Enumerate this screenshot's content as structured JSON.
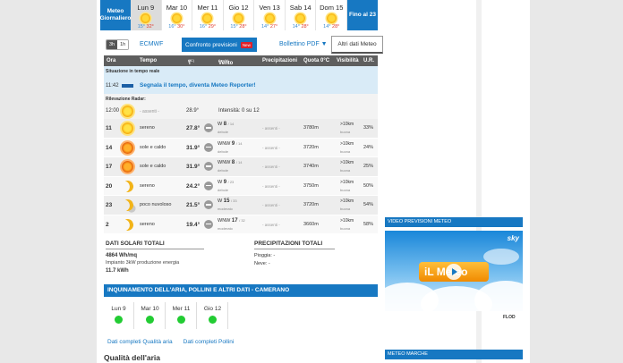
{
  "days": {
    "left_label": "Meteo Giornaliero",
    "right_label": "Fino al 23",
    "items": [
      {
        "name": "Lun 9",
        "min": "15°",
        "max": "32°",
        "active": true
      },
      {
        "name": "Mar 10",
        "min": "16°",
        "max": "30°"
      },
      {
        "name": "Mer 11",
        "min": "16°",
        "max": "29°"
      },
      {
        "name": "Gio 12",
        "min": "15°",
        "max": "28°"
      },
      {
        "name": "Ven 13",
        "min": "14°",
        "max": "27°"
      },
      {
        "name": "Sab 14",
        "min": "14°",
        "max": "28°"
      },
      {
        "name": "Dom 15",
        "min": "14°",
        "max": "28°"
      }
    ]
  },
  "toolbar": {
    "seg_3h": "3h",
    "seg_1h": "1h",
    "model": "ECMWF",
    "compare": "Confronto previsioni",
    "new_badge": "New",
    "pdf": "Bollettino PDF ▼",
    "altri": "Altri dati Meteo"
  },
  "table": {
    "headers": {
      "ora": "Ora",
      "tempo": "Tempo",
      "t": "T",
      "t_unit": "(°C)",
      "vento": "Vento",
      "vento_unit": "(km/h)",
      "prec": "Precipitazioni",
      "quota": "Quota 0°C",
      "vis": "Visibilità",
      "ur": "U.R."
    },
    "realtime": {
      "label": "Situazione in tempo reale",
      "time": "11:42",
      "msg": "Segnala il tempo, diventa Meteo Reporter!"
    },
    "radar": {
      "label": "Rilevazione Radar:",
      "time": "12:00",
      "assenti": "- assenti -",
      "temp": "28.9°",
      "intensity": "Intensità: 0 su 12"
    },
    "rows": [
      {
        "ora": "11",
        "icon": "sun",
        "cielo": "sereno",
        "temp": "27.8°",
        "dir": "W",
        "speed": "8",
        "gust": "/ 14",
        "desc": "debole",
        "prec": "- assenti -",
        "zero": "3780m",
        "vis": ">10km",
        "visd": "buona",
        "ur": "33%"
      },
      {
        "ora": "14",
        "icon": "hot",
        "cielo": "sole e caldo",
        "temp": "31.9°",
        "dir": "WNW",
        "speed": "9",
        "gust": "/ 14",
        "desc": "debole",
        "prec": "- assenti -",
        "zero": "3720m",
        "vis": ">10km",
        "visd": "buona",
        "ur": "24%"
      },
      {
        "ora": "17",
        "icon": "hot",
        "cielo": "sole e caldo",
        "temp": "31.9°",
        "dir": "WNW",
        "speed": "8",
        "gust": "/ 14",
        "desc": "debole",
        "prec": "- assenti -",
        "zero": "3740m",
        "vis": ">10km",
        "visd": "buona",
        "ur": "25%"
      },
      {
        "ora": "20",
        "icon": "moon",
        "cielo": "sereno",
        "temp": "24.2°",
        "dir": "W",
        "speed": "9",
        "gust": "/ 23",
        "desc": "debole",
        "prec": "- assenti -",
        "zero": "3750m",
        "vis": ">10km",
        "visd": "buona",
        "ur": "50%"
      },
      {
        "ora": "23",
        "icon": "mooncloud",
        "cielo": "poco nuvoloso",
        "temp": "21.5°",
        "dir": "W",
        "speed": "15",
        "gust": "/ 33",
        "desc": "moderato",
        "prec": "- assenti -",
        "zero": "3720m",
        "vis": ">10km",
        "visd": "buona",
        "ur": "54%"
      },
      {
        "ora": "2",
        "icon": "moon",
        "cielo": "sereno",
        "temp": "19.4°",
        "dir": "WNW",
        "speed": "17",
        "gust": "/ 32",
        "desc": "moderato",
        "prec": "- assenti -",
        "zero": "3660m",
        "vis": ">10km",
        "visd": "buona",
        "ur": "58%"
      }
    ]
  },
  "solar": {
    "title": "DATI SOLARI TOTALI",
    "value": "4864 Wh/mq",
    "impianto": "Impianto 3kW produzione energia",
    "kwh": "11.7 kWh"
  },
  "precip": {
    "title": "PRECIPITAZIONI TOTALI",
    "pioggia": "Pioggia: -",
    "neve": "Neve: -"
  },
  "pollution": {
    "header": "INQUINAMENTO DELL'ARIA, POLLINI E ALTRI DATI - CAMERANO",
    "days": [
      "Lun 9",
      "Mar 10",
      "Mer 11",
      "Gio 12"
    ],
    "link_air": "Dati completi Qualità aria",
    "link_pollen": "Dati completi Pollini",
    "quality_title": "Qualità dell'aria",
    "dot_color": "#22cc33"
  },
  "sidebar": {
    "video_header": "VIDEO PREVISIONI METEO",
    "sky": "sky",
    "logo": "iL Meteo",
    "flod": "FLOD",
    "marche_header": "METEO MARCHE"
  }
}
